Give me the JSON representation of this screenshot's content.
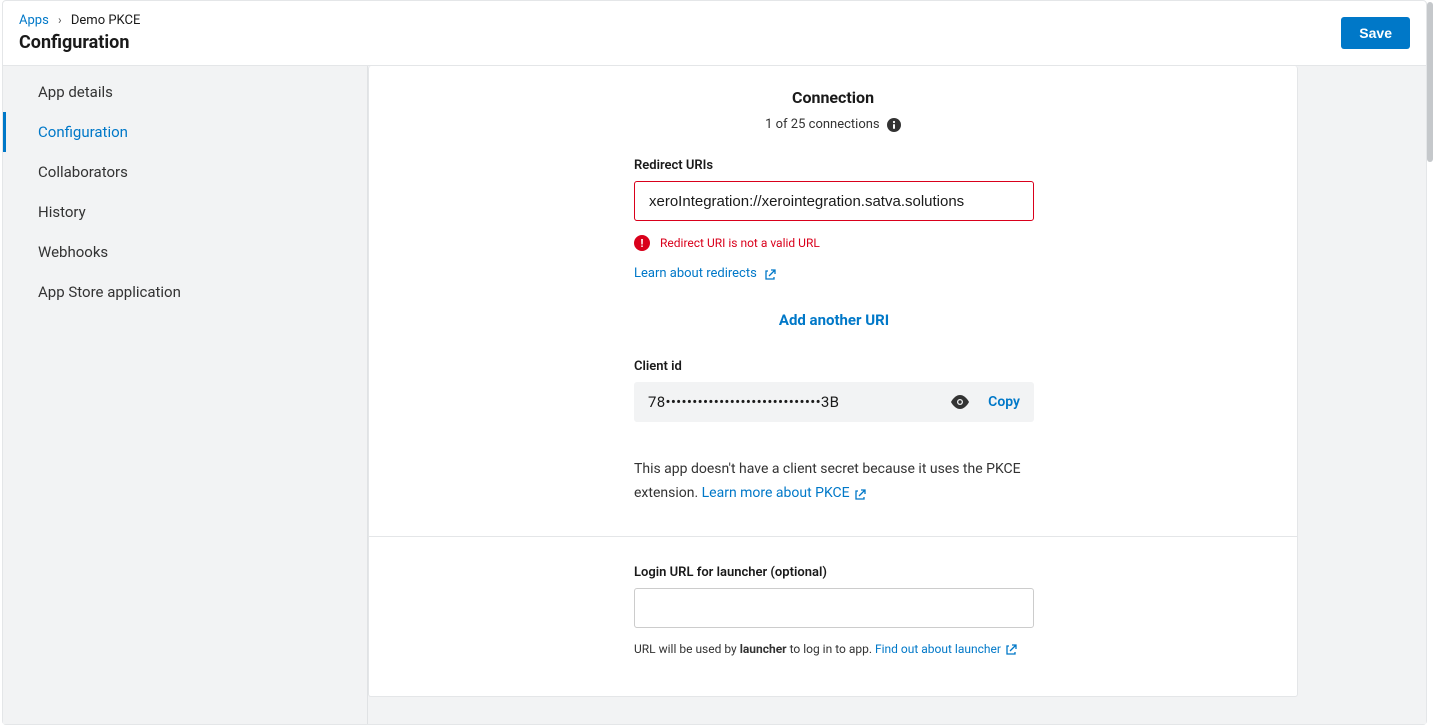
{
  "breadcrumb": {
    "root": "Apps",
    "current": "Demo PKCE"
  },
  "page_title": "Configuration",
  "save_button": "Save",
  "sidebar": {
    "items": [
      {
        "label": "App details",
        "active": false
      },
      {
        "label": "Configuration",
        "active": true
      },
      {
        "label": "Collaborators",
        "active": false
      },
      {
        "label": "History",
        "active": false
      },
      {
        "label": "Webhooks",
        "active": false
      },
      {
        "label": "App Store application",
        "active": false
      }
    ]
  },
  "connection": {
    "title": "Connection",
    "count_text": "1 of 25 connections",
    "redirect_label": "Redirect URIs",
    "redirect_value": "xeroIntegration://xerointegration.satva.solutions",
    "error_text": "Redirect URI is not a valid URL",
    "learn_redirects": "Learn about redirects",
    "add_another": "Add another URI",
    "client_id_label": "Client id",
    "client_id_value": "78•••••••••••••••••••••••••••••3B",
    "copy_label": "Copy",
    "pkce_note_prefix": "This app doesn't have a client secret because it uses the PKCE extension. ",
    "pkce_learn_more": "Learn more about PKCE"
  },
  "login": {
    "label": "Login URL for launcher (optional)",
    "value": "",
    "desc_prefix": "URL will be used by ",
    "desc_bold": "launcher",
    "desc_suffix": " to log in to app. ",
    "find_out": "Find out about launcher"
  }
}
